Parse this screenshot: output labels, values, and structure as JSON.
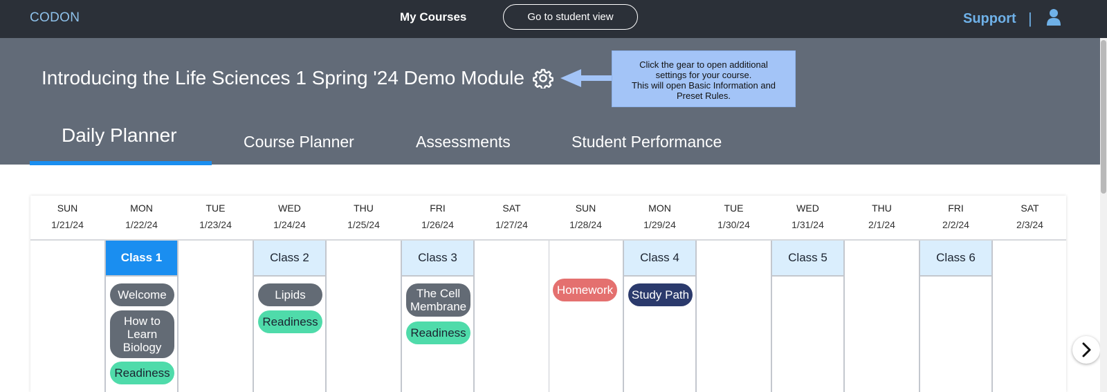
{
  "topbar": {
    "brand": "CODON",
    "nav_my_courses": "My Courses",
    "student_view_label": "Go to student view",
    "support_label": "Support",
    "divider": "|",
    "user_icon": "user-icon"
  },
  "header": {
    "course_title": "Introducing the Life Sciences 1 Spring '24 Demo Module",
    "gear_icon": "gear-icon",
    "callout": {
      "line1": "Click the gear to open additional",
      "line2": "settings for your course.",
      "line3": "This will open Basic Information and",
      "line4": "Preset Rules."
    },
    "tabs": [
      {
        "label": "Daily Planner",
        "active": true
      },
      {
        "label": "Course Planner",
        "active": false
      },
      {
        "label": "Assessments",
        "active": false
      },
      {
        "label": "Student Performance",
        "active": false
      }
    ]
  },
  "calendar": {
    "days": [
      {
        "name": "SUN",
        "date": "1/21/24"
      },
      {
        "name": "MON",
        "date": "1/22/24"
      },
      {
        "name": "TUE",
        "date": "1/23/24"
      },
      {
        "name": "WED",
        "date": "1/24/24"
      },
      {
        "name": "THU",
        "date": "1/25/24"
      },
      {
        "name": "FRI",
        "date": "1/26/24"
      },
      {
        "name": "SAT",
        "date": "1/27/24"
      },
      {
        "name": "SUN",
        "date": "1/28/24"
      },
      {
        "name": "MON",
        "date": "1/29/24"
      },
      {
        "name": "TUE",
        "date": "1/30/24"
      },
      {
        "name": "WED",
        "date": "1/31/24"
      },
      {
        "name": "THU",
        "date": "2/1/24"
      },
      {
        "name": "FRI",
        "date": "2/2/24"
      },
      {
        "name": "SAT",
        "date": "2/3/24"
      }
    ],
    "classes": {
      "class1": "Class 1",
      "class2": "Class 2",
      "class3": "Class 3",
      "class4": "Class 4",
      "class5": "Class 5",
      "class6": "Class 6"
    },
    "items": {
      "welcome": "Welcome",
      "how_to_learn_line1": "How to",
      "how_to_learn_line2": "Learn",
      "how_to_learn_line3": "Biology",
      "readiness": "Readiness",
      "lipids": "Lipids",
      "cell_membrane_line1": "The Cell",
      "cell_membrane_line2": "Membrane",
      "homework": "Homework",
      "study_path": "Study Path"
    },
    "next_icon": "chevron-right-icon"
  },
  "colors": {
    "topbar_bg": "#2b3038",
    "header_bg": "#626b78",
    "accent": "#1a8ef0",
    "class_tile": "#daeefd",
    "pill_gray": "#636b75",
    "pill_green": "#4fdbaa",
    "pill_red": "#e4706f",
    "pill_navy": "#2b3a6c",
    "callout_bg": "#a3c4f7"
  }
}
